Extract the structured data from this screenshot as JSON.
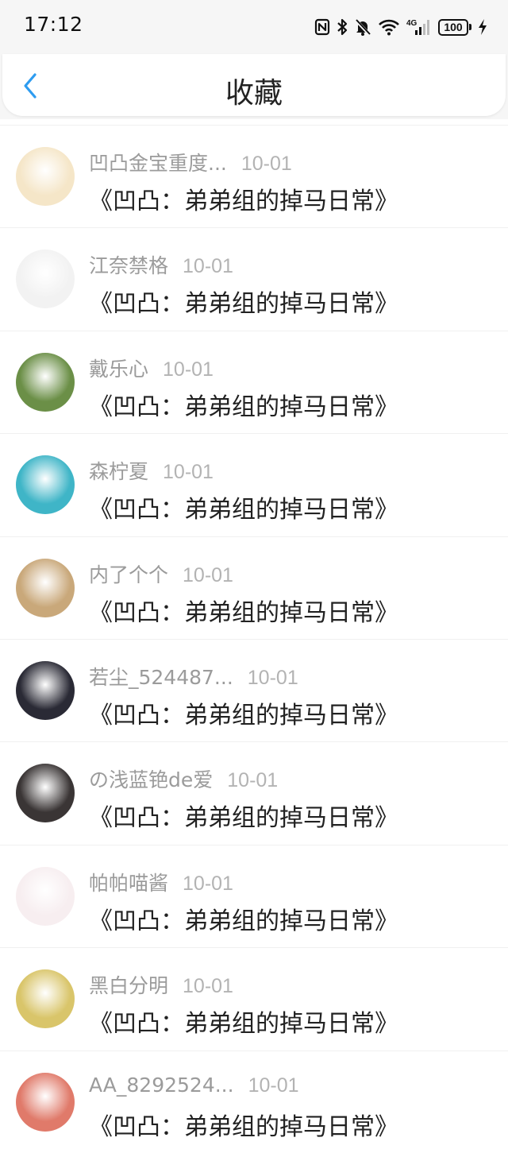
{
  "status_bar": {
    "time": "17:12",
    "icons": [
      "nfc-icon",
      "bluetooth-icon",
      "mute-icon",
      "wifi-icon",
      "signal-4g-icon",
      "battery-icon",
      "charging-icon"
    ],
    "network": "4G",
    "battery": "100"
  },
  "header": {
    "title": "收藏",
    "back_icon": "chevron-left-icon",
    "accent_color": "#2e9cf0"
  },
  "favorites": [
    {
      "user": "凹凸金宝重度...",
      "date": "10-01",
      "content": "《凹凸：弟弟组的掉马日常》",
      "avatar_color": "#f5e6c8"
    },
    {
      "user": "江奈禁格",
      "date": "10-01",
      "content": "《凹凸：弟弟组的掉马日常》",
      "avatar_color": "#f2f2f2"
    },
    {
      "user": "戴乐心",
      "date": "10-01",
      "content": "《凹凸：弟弟组的掉马日常》",
      "avatar_color": "#6b8f47"
    },
    {
      "user": "森柠夏",
      "date": "10-01",
      "content": "《凹凸：弟弟组的掉马日常》",
      "avatar_color": "#3fb5c7"
    },
    {
      "user": "内了个个",
      "date": "10-01",
      "content": "《凹凸：弟弟组的掉马日常》",
      "avatar_color": "#c9a87a"
    },
    {
      "user": "若尘_524487...",
      "date": "10-01",
      "content": "《凹凸：弟弟组的掉马日常》",
      "avatar_color": "#2a2a35"
    },
    {
      "user": "の浅蓝铯de爱",
      "date": "10-01",
      "content": "《凹凸：弟弟组的掉马日常》",
      "avatar_color": "#3a3535"
    },
    {
      "user": "帕帕喵酱",
      "date": "10-01",
      "content": "《凹凸：弟弟组的掉马日常》",
      "avatar_color": "#f7eef0"
    },
    {
      "user": "黑白分明",
      "date": "10-01",
      "content": "《凹凸：弟弟组的掉马日常》",
      "avatar_color": "#d9c56a"
    },
    {
      "user": "AA_8292524...",
      "date": "10-01",
      "content": "《凹凸：弟弟组的掉马日常》",
      "avatar_color": "#e07a6a"
    }
  ]
}
